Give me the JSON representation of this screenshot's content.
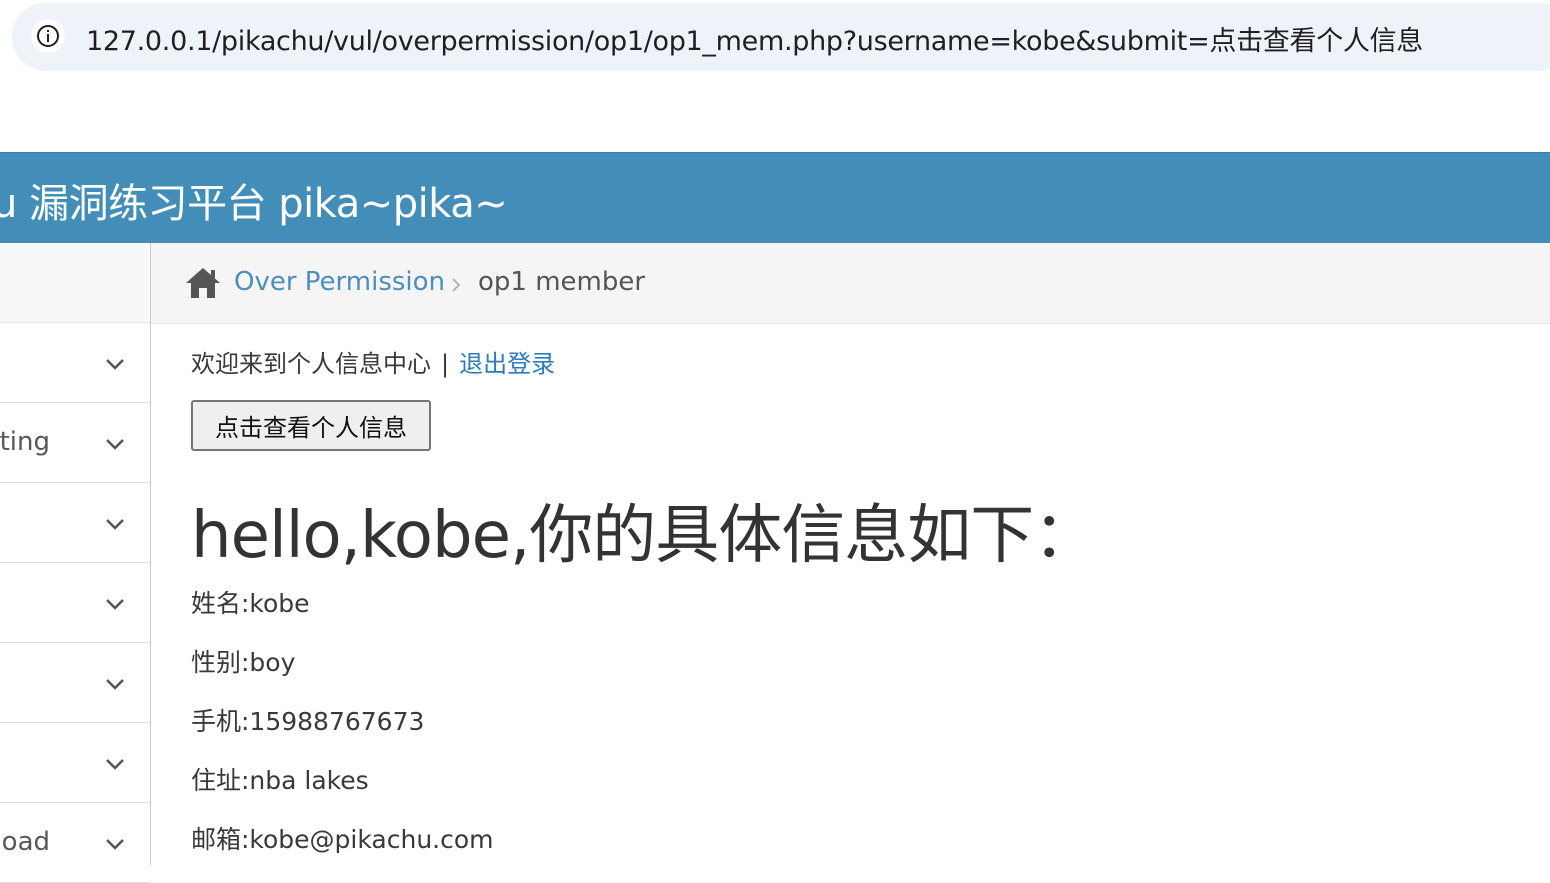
{
  "browser": {
    "url": "127.0.0.1/pikachu/vul/overpermission/op1/op1_mem.php?username=kobe&submit=点击查看个人信息",
    "info_icon": "info-icon"
  },
  "header": {
    "title": "u 漏洞练习平台 pika~pika~"
  },
  "sidebar": {
    "items": [
      {
        "label": ""
      },
      {
        "label": "pting"
      },
      {
        "label": ""
      },
      {
        "label": ""
      },
      {
        "label": ""
      },
      {
        "label": ""
      },
      {
        "label": "nload"
      }
    ]
  },
  "breadcrumb": {
    "home_icon": "home-icon",
    "section": "Over Permission",
    "current": "op1 member"
  },
  "main": {
    "welcome_text": "欢迎来到个人信息中心",
    "separator": "|",
    "logout_link": "退出登录",
    "view_button": "点击查看个人信息",
    "heading": "hello,kobe,你的具体信息如下：",
    "info": [
      "姓名:kobe",
      "性别:boy",
      "手机:15988767673",
      "住址:nba lakes",
      "邮箱:kobe@pikachu.com"
    ]
  }
}
